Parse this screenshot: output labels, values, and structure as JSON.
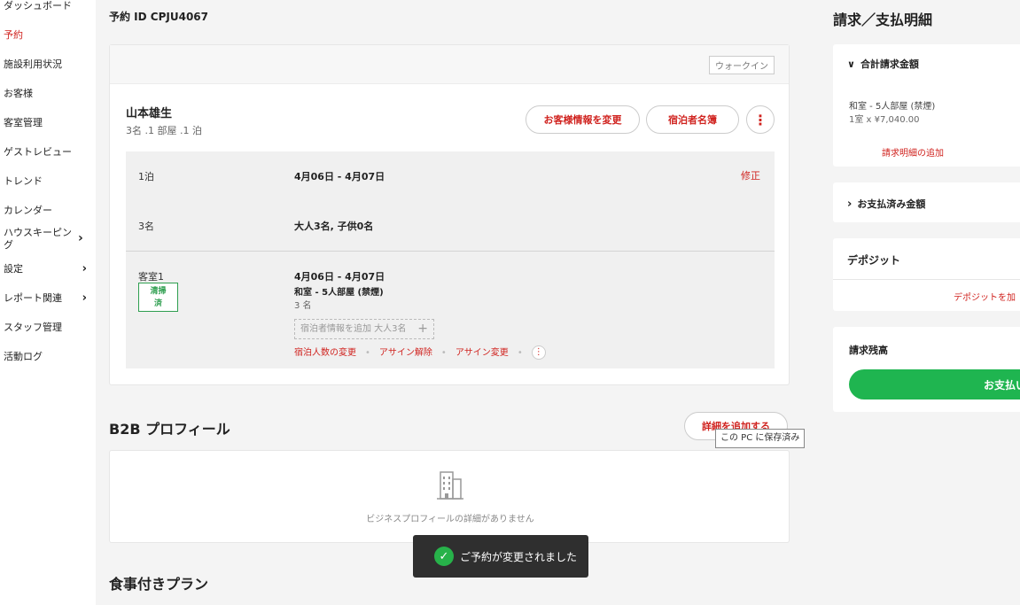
{
  "sidebar": {
    "items": [
      {
        "label": "ダッシュボード",
        "has_arrow": false
      },
      {
        "label": "予約",
        "has_arrow": false,
        "active": true
      },
      {
        "label": "施設利用状況",
        "has_arrow": false
      },
      {
        "label": "お客様",
        "has_arrow": false
      },
      {
        "label": "客室管理",
        "has_arrow": false
      },
      {
        "label": "ゲストレビュー",
        "has_arrow": false
      },
      {
        "label": "トレンド",
        "has_arrow": false
      },
      {
        "label": "カレンダー",
        "has_arrow": false
      },
      {
        "label": "ハウスキーピング",
        "has_arrow": true
      },
      {
        "label": "設定",
        "has_arrow": true
      },
      {
        "label": "レポート関連",
        "has_arrow": true
      },
      {
        "label": "スタッフ管理",
        "has_arrow": false
      },
      {
        "label": "活動ログ",
        "has_arrow": false
      }
    ],
    "arrow_glyph": "›",
    "active_color": "#d0231f"
  },
  "booking": {
    "id_label": "予約 ID CPJU4067",
    "channel_badge": "ウォークイン",
    "guest_name": "山本雄生",
    "guest_summary": "3名 .1 部屋 .1 泊",
    "edit_guest_button": "お客様情報を変更",
    "guest_register_button": "宿泊者名簿",
    "more_icon": "⋮",
    "nights_label": "1泊",
    "dates": "4月06日 - 4月07日",
    "edit_link": "修正",
    "guests_label": "3名",
    "guests_detail": "大人3名, 子供0名",
    "room": {
      "label": "客室1",
      "status_badge": "清掃\n済",
      "dates": "4月06日 - 4月07日",
      "type": "和室 - 5人部屋 (禁煙)",
      "guests": "3 名",
      "add_guest_info": "宿泊者情報を追加 大人3名",
      "add_icon": "+",
      "actions": [
        "宿泊人数の変更",
        "アサイン解除",
        "アサイン変更"
      ]
    }
  },
  "b2b": {
    "title": "B2B プロフィール",
    "add_button": "詳細を追加する",
    "tooltip": "この PC に保存済み",
    "empty_text": "ビジネスプロフィールの詳細がありません"
  },
  "meal": {
    "title": "食事付きプラン"
  },
  "toast": {
    "message": "ご予約が変更されました",
    "icon": "✓"
  },
  "billing": {
    "title": "請求／支払明細",
    "total_section": {
      "label": "合計請求金額",
      "expanded": true,
      "item_name": "和室 - 5人部屋 (禁煙)",
      "item_price": "1室 x ¥7,040.00",
      "add_link": "請求明細の追加"
    },
    "paid_section": {
      "label": "お支払済み金額",
      "expanded": false
    },
    "deposit": {
      "label": "デポジット",
      "add_link": "デポジットを加"
    },
    "balance": {
      "label": "請求残高",
      "pay_button": "お支払い"
    },
    "chevron_open": "⌄",
    "chevron_closed": "›"
  }
}
